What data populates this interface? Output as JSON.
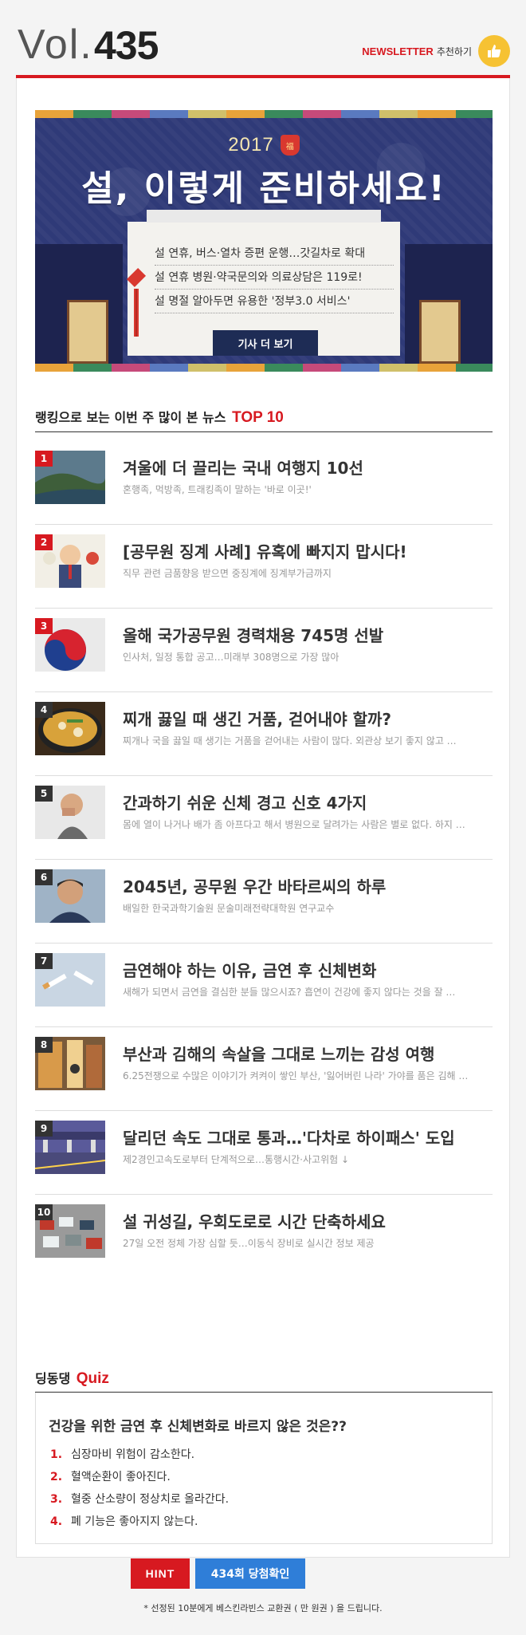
{
  "header": {
    "vol_prefix": "Vol.",
    "vol_number": "435",
    "newsletter_label": "NEWSLETTER",
    "recommend_label": "추천하기",
    "thumb_icon": "thumbs-up-icon"
  },
  "colors": {
    "accent_red": "#d71920",
    "banner_navy": "#2f3a78",
    "button_blue": "#2f7ed8",
    "thumb_yellow": "#f6c233"
  },
  "banner": {
    "year": "2017",
    "pouch_text": "福",
    "headline": "설, 이렇게 준비하세요!",
    "lines": [
      "설 연휴, 버스·열차 증편 운행…갓길차로 확대",
      "설 연휴 병원·약국문의와 의료상담은 119로!",
      "설 명절 알아두면 유용한 '정부3.0 서비스'"
    ],
    "more_button": "기사 더 보기"
  },
  "ranking": {
    "title": "랭킹으로 보는 이번 주 많이 본 뉴스",
    "title_accent": "TOP 10",
    "items": [
      {
        "rank": "1",
        "title": "겨울에 더 끌리는 국내 여행지 10선",
        "desc": "혼행족, 먹방족, 트래킹족이 말하는 '바로 이곳!'"
      },
      {
        "rank": "2",
        "title": "[공무원 징계 사례] 유혹에 빠지지 맙시다!",
        "desc": "직무 관련 금품향응 받으면 중징계에 징계부가금까지"
      },
      {
        "rank": "3",
        "title": "올해 국가공무원 경력채용 745명 선발",
        "desc": "인사처, 일정 통합 공고…미래부 308명으로 가장 많아"
      },
      {
        "rank": "4",
        "title": "찌개 끓일 때 생긴 거품, 걷어내야 할까?",
        "desc": "찌개나 국을 끓일 때 생기는 거품을 걷어내는 사람이 많다. 외관상 보기 좋지 않고 …"
      },
      {
        "rank": "5",
        "title": "간과하기 쉬운 신체 경고 신호 4가지",
        "desc": "몸에 열이 나거나 배가 좀 아프다고 해서 병원으로 달려가는 사람은 별로 없다. 하지 …"
      },
      {
        "rank": "6",
        "title": "2045년, 공무원 우간 바타르씨의 하루",
        "desc": "배일한 한국과학기술원 문술미래전략대학원 연구교수"
      },
      {
        "rank": "7",
        "title": "금연해야 하는 이유, 금연 후 신체변화",
        "desc": "새해가 되면서 금연을 결심한 분들 많으시죠? 흡연이 건강에 좋지 않다는 것을 잘 …"
      },
      {
        "rank": "8",
        "title": "부산과 김해의 속살을 그대로 느끼는 감성 여행",
        "desc": "6.25전쟁으로 수많은 이야기가 켜켜이 쌓인 부산, '잃어버린 나라' 가야를 품은 김해 …"
      },
      {
        "rank": "9",
        "title": "달리던 속도 그대로 통과…'다차로 하이패스' 도입",
        "desc": "제2경인고속도로부터 단계적으로…통행시간·사고위험 ↓"
      },
      {
        "rank": "10",
        "title": "설 귀성길, 우회도로로 시간 단축하세요",
        "desc": "27일 오전 정체 가장 심할 듯…이동식 장비로 실시간 정보 제공"
      }
    ]
  },
  "quiz": {
    "title": "딩동댕",
    "title_accent": "Quiz",
    "question": "건강을 위한 금연 후 신체변화로 바르지 않은 것은??",
    "options": [
      {
        "num": "1.",
        "text": "심장마비 위험이 감소한다."
      },
      {
        "num": "2.",
        "text": "혈액순환이 좋아진다."
      },
      {
        "num": "3.",
        "text": "혈중 산소량이 정상치로 올라간다."
      },
      {
        "num": "4.",
        "text": "폐 기능은 좋아지지 않는다."
      }
    ],
    "hint_button": "HINT",
    "winners_button": "434회 당첨확인",
    "prize_note": "* 선정된 10분에게 베스킨라빈스 교환권 ( 만 원권 ) 을 드립니다."
  }
}
